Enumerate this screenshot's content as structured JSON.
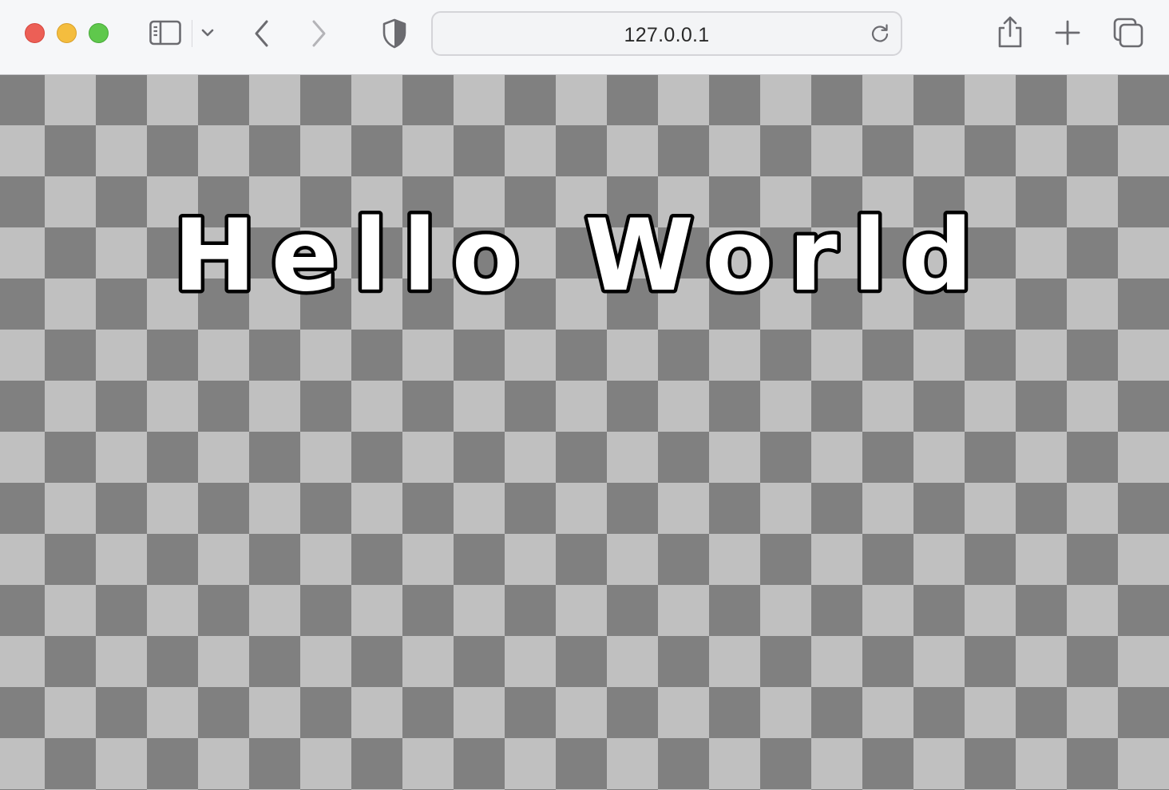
{
  "browser": {
    "address": "127.0.0.1"
  },
  "page": {
    "text": "Hello World",
    "colors": {
      "checker_dark": "#808080",
      "checker_light": "#c0c0c0",
      "text_fill": "#ffffff",
      "text_outline": "#000000"
    }
  },
  "icons": {
    "sidebar": "sidebar-icon",
    "tab_overview": "chevron-down-icon",
    "back": "chevron-left-icon",
    "forward": "chevron-right-icon",
    "privacy": "shield-icon",
    "reload": "reload-icon",
    "share": "share-icon",
    "new_tab": "plus-icon",
    "tabs": "tabs-overview-icon"
  }
}
